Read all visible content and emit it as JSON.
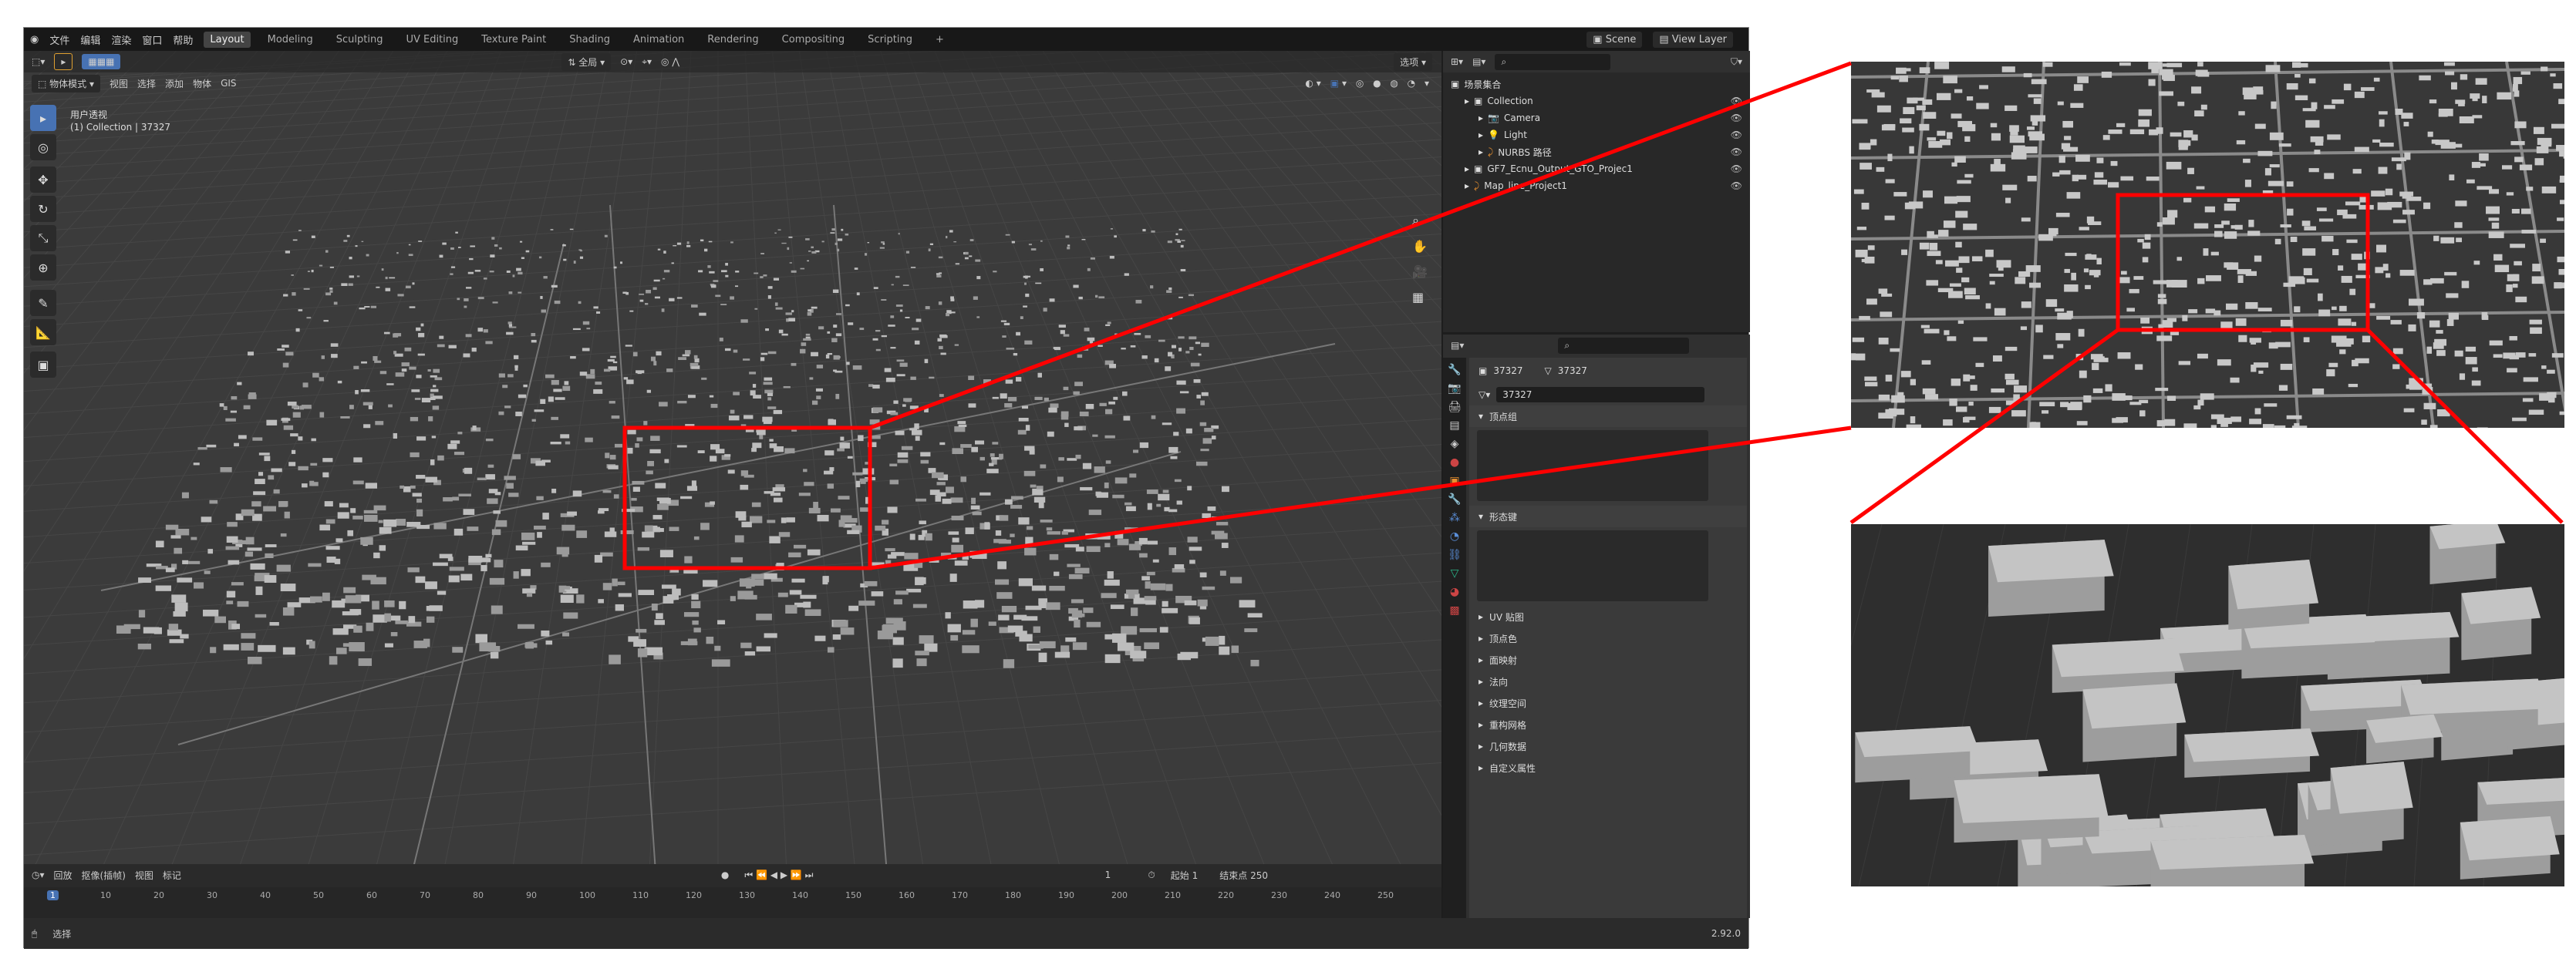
{
  "topbar": {
    "menus": [
      "文件",
      "编辑",
      "渲染",
      "窗口",
      "帮助"
    ],
    "workspaces": [
      "Layout",
      "Modeling",
      "Sculpting",
      "UV Editing",
      "Texture Paint",
      "Shading",
      "Animation",
      "Rendering",
      "Compositing",
      "Scripting",
      "+"
    ],
    "scene": "Scene",
    "view_layer": "View Layer"
  },
  "viewport": {
    "mode": "物体模式",
    "menus": [
      "视图",
      "选择",
      "添加",
      "物体",
      "GIS"
    ],
    "transform": "全局",
    "options": "选项",
    "view_name": "用户透视",
    "collection_info": "(1) Collection | 37327"
  },
  "outliner": {
    "items": [
      {
        "label": "场景集合",
        "level": 0
      },
      {
        "label": "Collection",
        "level": 1
      },
      {
        "label": "Camera",
        "level": 2
      },
      {
        "label": "Light",
        "level": 2
      },
      {
        "label": "NURBS 路径",
        "level": 2
      },
      {
        "label": "GF7_Ecnu_Output_GTO_Projec1",
        "level": 1
      },
      {
        "label": "Map_line_Project1",
        "level": 1
      }
    ]
  },
  "properties": {
    "object_name": "37327",
    "mesh_name": "37327",
    "data_field": "37327",
    "panels": [
      "顶点组",
      "形态键"
    ],
    "collapsed": [
      "UV 贴图",
      "顶点色",
      "面映射",
      "法向",
      "纹理空间",
      "重构网格",
      "几何数据",
      "自定义属性"
    ]
  },
  "timeline": {
    "menus": [
      "回放",
      "抠像(插帧)",
      "视图",
      "标记"
    ],
    "current_frame": "1",
    "start_label": "起始",
    "start": "1",
    "end_label": "结束点",
    "end": "250",
    "ticks": [
      "1",
      "10",
      "20",
      "30",
      "40",
      "50",
      "60",
      "70",
      "80",
      "90",
      "100",
      "110",
      "120",
      "130",
      "140",
      "150",
      "160",
      "170",
      "180",
      "190",
      "200",
      "210",
      "220",
      "230",
      "240",
      "250"
    ]
  },
  "status": {
    "select": "选择",
    "version": "2.92.0"
  },
  "colors": {
    "highlight": "#ff0000",
    "accent": "#4772b3"
  }
}
